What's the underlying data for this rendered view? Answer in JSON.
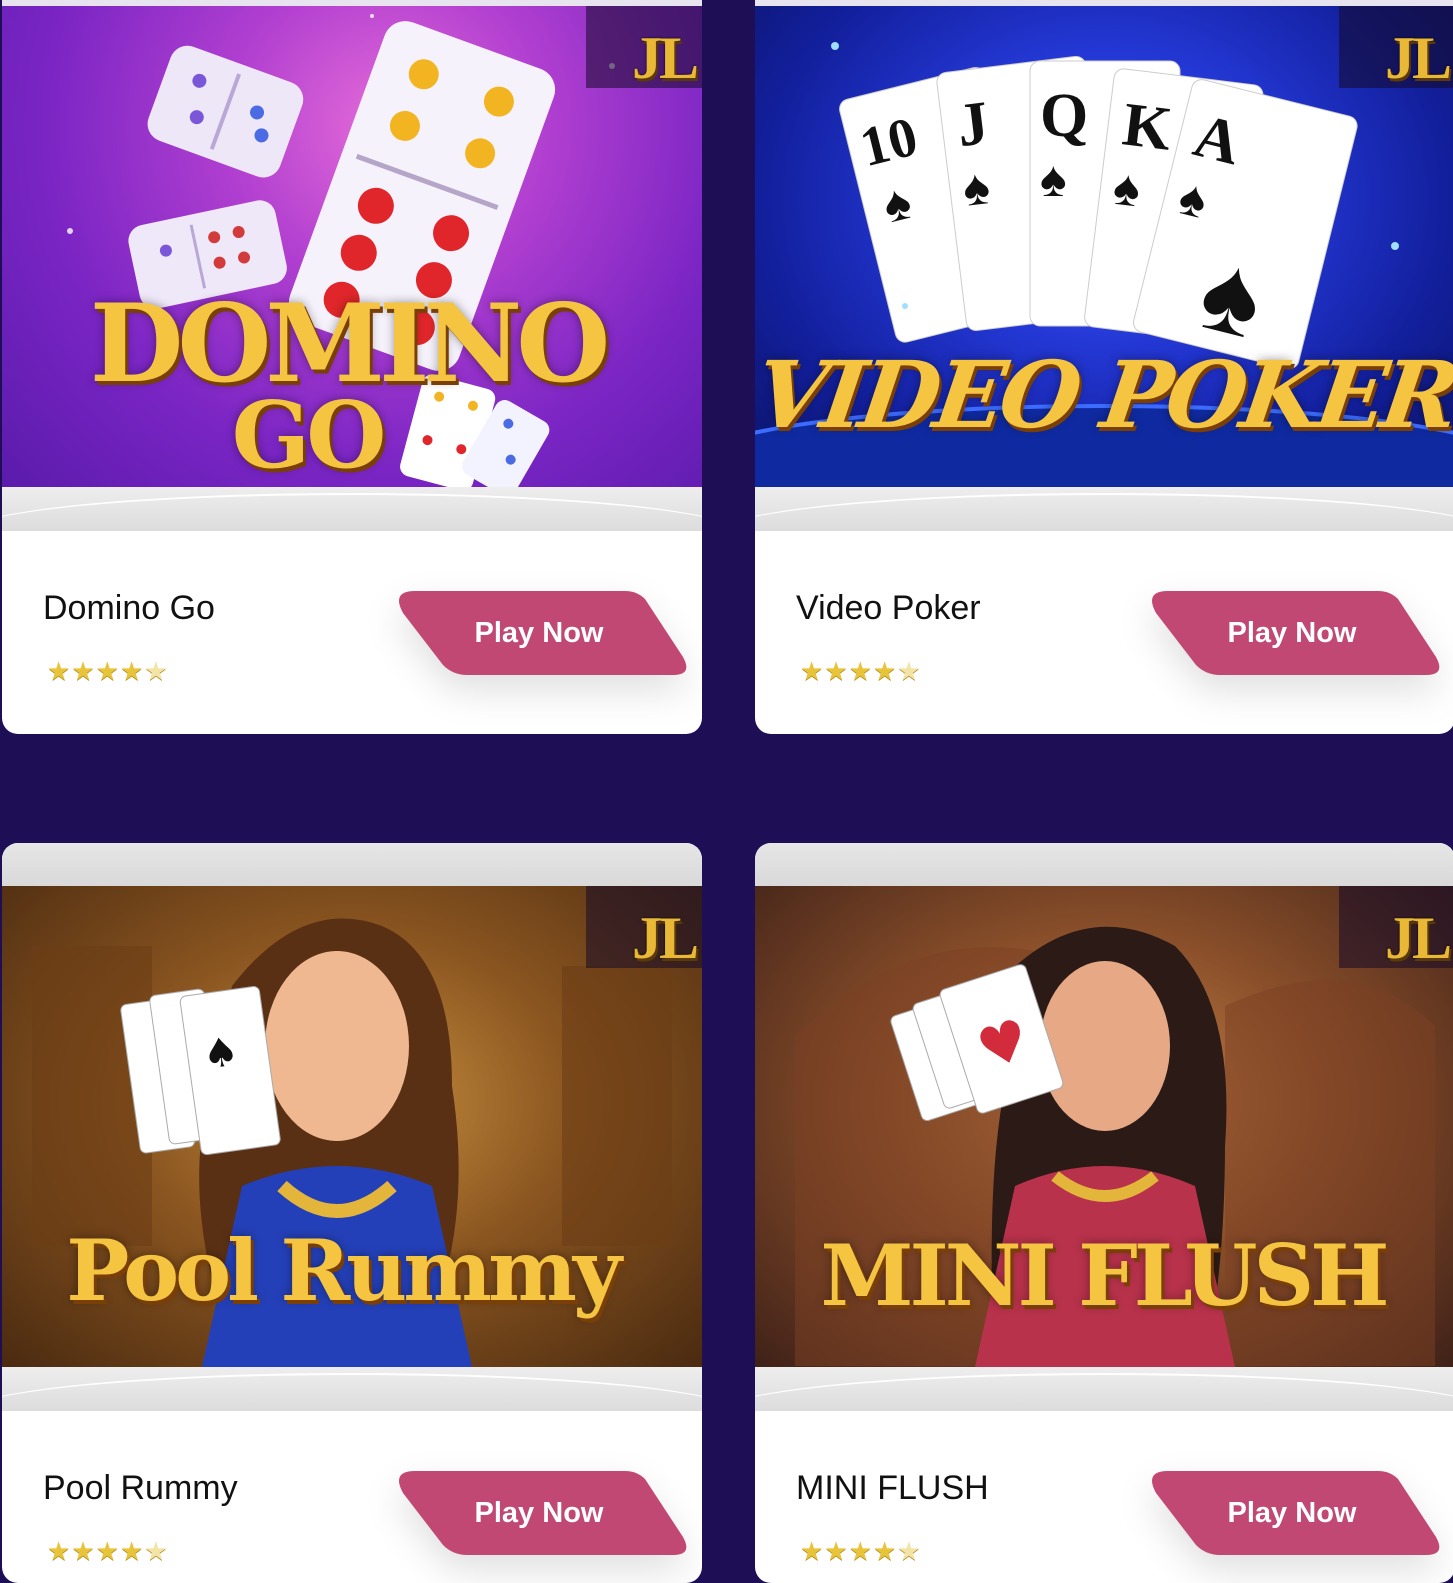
{
  "brand_badge": "JL",
  "cta_label": "Play Now",
  "games": [
    {
      "title": "Domino Go",
      "logo_line1": "DOMINO",
      "logo_line2": "GO",
      "rating": 4.5
    },
    {
      "title": "Video Poker",
      "logo_line1": "VIDEO POKER",
      "logo_line2": "",
      "rating": 4.5
    },
    {
      "title": "Pool Rummy",
      "logo_line1": "Pool Rummy",
      "logo_line2": "",
      "rating": 4.5
    },
    {
      "title": "MINI FLUSH",
      "logo_line1": "MINI FLUSH",
      "logo_line2": "",
      "rating": 4.5
    }
  ],
  "colors": {
    "page_bg": "#1d0e55",
    "cta": "#c04872",
    "star": "#e8c43a"
  }
}
